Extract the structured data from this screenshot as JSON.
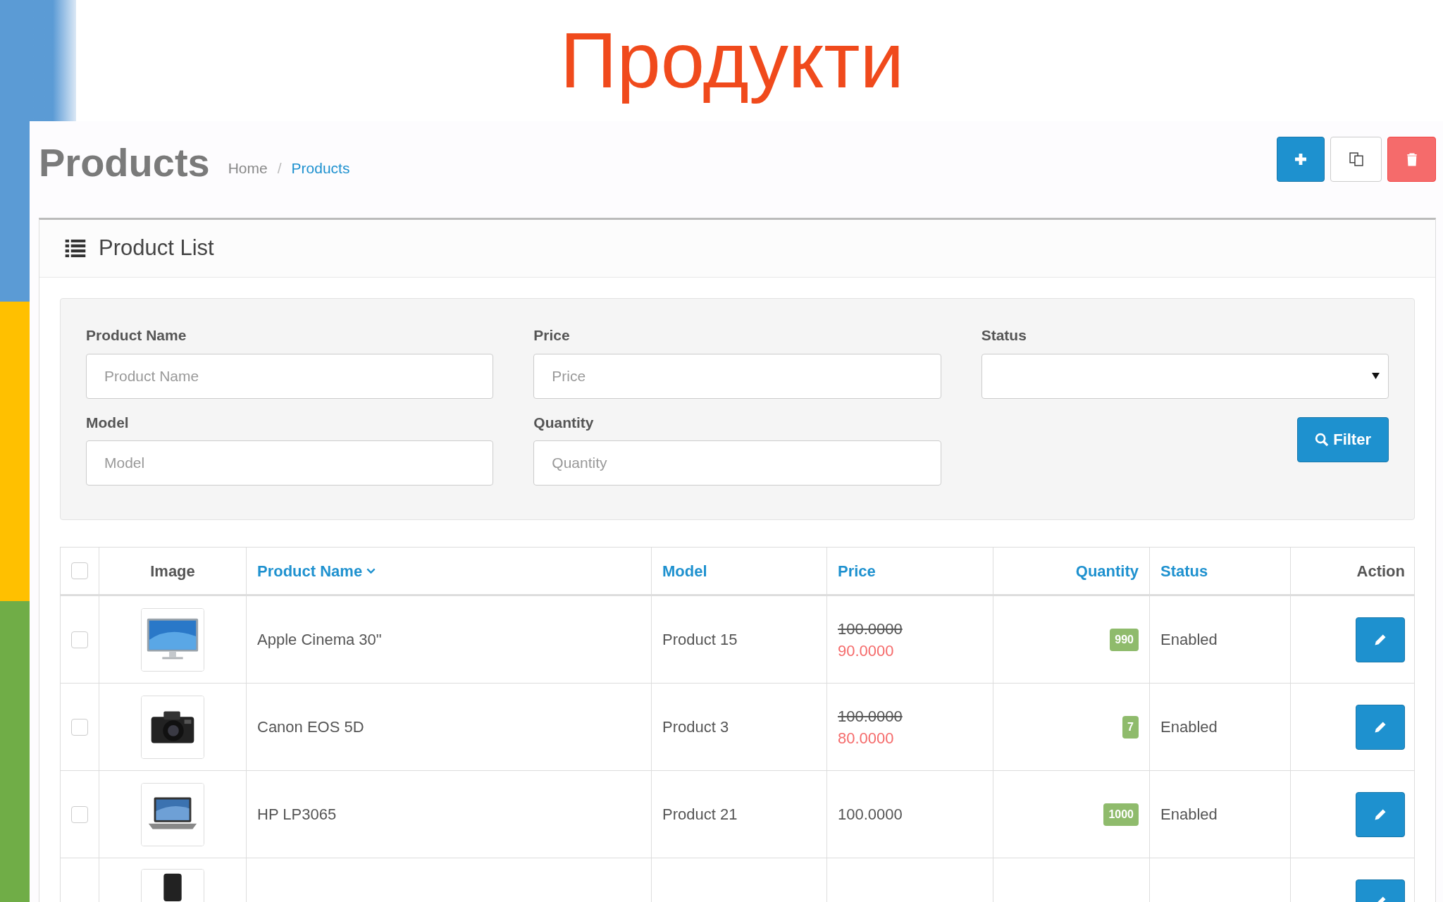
{
  "slide_title": "Продукти",
  "page": {
    "title": "Products",
    "breadcrumb_separator": "/",
    "breadcrumb": [
      {
        "label": "Home",
        "current": false
      },
      {
        "label": "Products",
        "current": true
      }
    ]
  },
  "toolbar": [
    {
      "kind": "add"
    },
    {
      "kind": "copy"
    },
    {
      "kind": "delete"
    }
  ],
  "panel": {
    "title": "Product List"
  },
  "filters": [
    {
      "label": "Product Name",
      "placeholder": "Product Name",
      "kind": "text"
    },
    {
      "label": "Price",
      "placeholder": "Price",
      "kind": "text"
    },
    {
      "label": "Status",
      "kind": "select"
    },
    {
      "label": "Model",
      "placeholder": "Model",
      "kind": "text"
    },
    {
      "label": "Quantity",
      "placeholder": "Quantity",
      "kind": "text"
    }
  ],
  "filter_button": "Filter",
  "table": {
    "select_all_checked": false,
    "columns": [
      {
        "label": "Image",
        "link": false,
        "sorted": false
      },
      {
        "label": "Product Name",
        "link": true,
        "sorted": true
      },
      {
        "label": "Model",
        "link": true,
        "sorted": false
      },
      {
        "label": "Price",
        "link": true,
        "sorted": false
      },
      {
        "label": "Quantity",
        "link": true,
        "sorted": false
      },
      {
        "label": "Status",
        "link": true,
        "sorted": false
      },
      {
        "label": "Action",
        "link": false,
        "sorted": false
      }
    ],
    "rows": [
      {
        "kind": "full",
        "selected": false,
        "name": "Apple Cinema 30\"",
        "model": "Product 15",
        "price_old": "100.0000",
        "price_special": "90.0000",
        "quantity": "990",
        "status": "Enabled"
      },
      {
        "kind": "full",
        "selected": false,
        "name": "Canon EOS 5D",
        "model": "Product 3",
        "price_old": "100.0000",
        "price_special": "80.0000",
        "quantity": "7",
        "status": "Enabled"
      },
      {
        "kind": "full",
        "selected": false,
        "name": "HP LP3065",
        "model": "Product 21",
        "price": "100.0000",
        "quantity": "1000",
        "status": "Enabled"
      },
      {
        "kind": "partial"
      }
    ]
  }
}
